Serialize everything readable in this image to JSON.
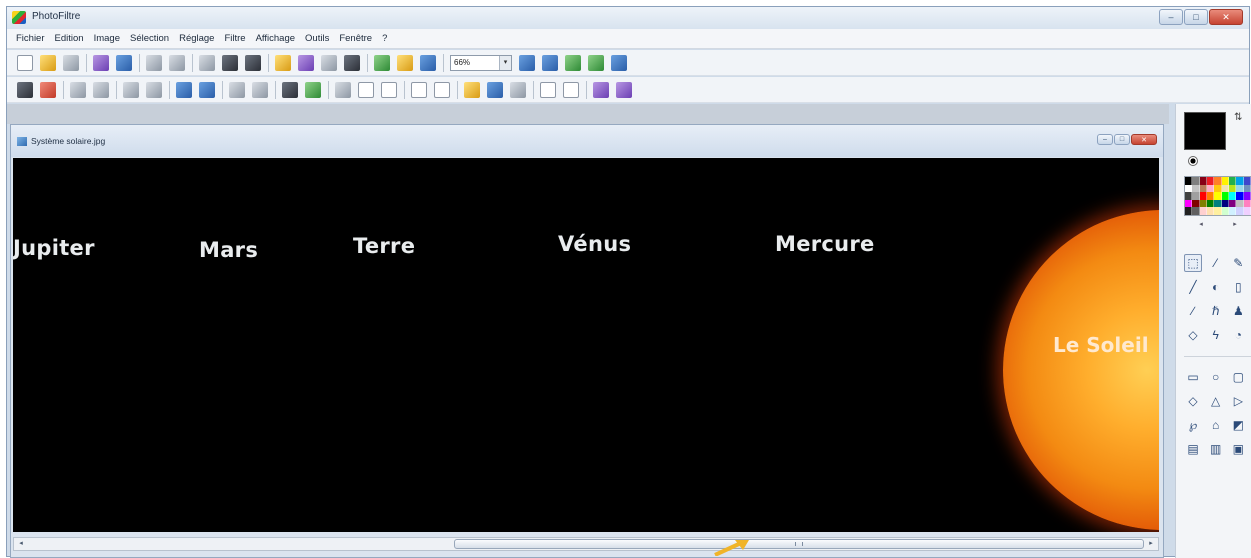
{
  "app": {
    "title": "PhotoFiltre",
    "window_buttons": [
      "–",
      "□",
      "✕"
    ]
  },
  "menu": [
    "Fichier",
    "Edition",
    "Image",
    "Sélection",
    "Réglage",
    "Filtre",
    "Affichage",
    "Outils",
    "Fenêtre",
    "?"
  ],
  "toolbar": {
    "zoom_value": "66%"
  },
  "document": {
    "title": "Système solaire.jpg"
  },
  "canvas": {
    "labels": [
      "Jupiter",
      "Mars",
      "Terre",
      "Vénus",
      "Mercure"
    ],
    "sun_label": "Le Soleil"
  },
  "colors": {
    "foreground": "#000000",
    "background": "#ffffff",
    "palette": [
      "#000000",
      "#7f7f7f",
      "#880015",
      "#ed1c24",
      "#ff7f27",
      "#fff200",
      "#22b14c",
      "#00a2e8",
      "#3f48cc",
      "#ffffff",
      "#c3c3c3",
      "#b97a57",
      "#ffaec9",
      "#ffc90e",
      "#efe4b0",
      "#b5e61d",
      "#99d9ea",
      "#7092be",
      "#404040",
      "#a0a0a0",
      "#ff0000",
      "#ff8000",
      "#ffff00",
      "#00ff00",
      "#00ffff",
      "#0000ff",
      "#8000ff",
      "#ff00ff",
      "#800000",
      "#808000",
      "#008000",
      "#008080",
      "#000080",
      "#800080",
      "#c0c0c0",
      "#ff80c0",
      "#202020",
      "#606060",
      "#ffd0d0",
      "#ffe0b0",
      "#fff0a0",
      "#d0ffd0",
      "#d0f0ff",
      "#d0d0ff",
      "#f0d0ff"
    ]
  },
  "tools": [
    "selection-arrow-icon",
    "pipette-icon",
    "magic-wand-icon",
    "line-icon",
    "fill-bucket-icon",
    "spray-icon",
    "brush-icon",
    "advanced-brush-icon",
    "stamp-icon",
    "blur-drop-icon",
    "smudge-icon",
    "eraser-icon"
  ],
  "shapes": [
    "rectangle-icon",
    "ellipse-icon",
    "rounded-rect-icon",
    "diamond-icon",
    "triangle-icon",
    "play-icon",
    "lasso-icon",
    "polygon-icon",
    "gradient-icon",
    "fit-width-icon",
    "fit-height-icon",
    "fit-page-icon"
  ]
}
